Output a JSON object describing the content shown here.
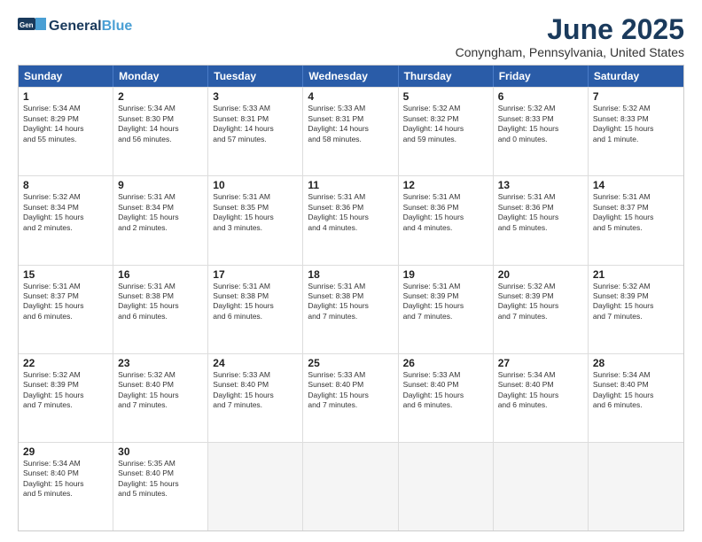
{
  "logo": {
    "line1a": "General",
    "line1b": "Blue",
    "tagline": ""
  },
  "title": "June 2025",
  "subtitle": "Conyngham, Pennsylvania, United States",
  "days_of_week": [
    "Sunday",
    "Monday",
    "Tuesday",
    "Wednesday",
    "Thursday",
    "Friday",
    "Saturday"
  ],
  "weeks": [
    [
      {
        "day": "1",
        "info": "Sunrise: 5:34 AM\nSunset: 8:29 PM\nDaylight: 14 hours\nand 55 minutes."
      },
      {
        "day": "2",
        "info": "Sunrise: 5:34 AM\nSunset: 8:30 PM\nDaylight: 14 hours\nand 56 minutes."
      },
      {
        "day": "3",
        "info": "Sunrise: 5:33 AM\nSunset: 8:31 PM\nDaylight: 14 hours\nand 57 minutes."
      },
      {
        "day": "4",
        "info": "Sunrise: 5:33 AM\nSunset: 8:31 PM\nDaylight: 14 hours\nand 58 minutes."
      },
      {
        "day": "5",
        "info": "Sunrise: 5:32 AM\nSunset: 8:32 PM\nDaylight: 14 hours\nand 59 minutes."
      },
      {
        "day": "6",
        "info": "Sunrise: 5:32 AM\nSunset: 8:33 PM\nDaylight: 15 hours\nand 0 minutes."
      },
      {
        "day": "7",
        "info": "Sunrise: 5:32 AM\nSunset: 8:33 PM\nDaylight: 15 hours\nand 1 minute."
      }
    ],
    [
      {
        "day": "8",
        "info": "Sunrise: 5:32 AM\nSunset: 8:34 PM\nDaylight: 15 hours\nand 2 minutes."
      },
      {
        "day": "9",
        "info": "Sunrise: 5:31 AM\nSunset: 8:34 PM\nDaylight: 15 hours\nand 2 minutes."
      },
      {
        "day": "10",
        "info": "Sunrise: 5:31 AM\nSunset: 8:35 PM\nDaylight: 15 hours\nand 3 minutes."
      },
      {
        "day": "11",
        "info": "Sunrise: 5:31 AM\nSunset: 8:36 PM\nDaylight: 15 hours\nand 4 minutes."
      },
      {
        "day": "12",
        "info": "Sunrise: 5:31 AM\nSunset: 8:36 PM\nDaylight: 15 hours\nand 4 minutes."
      },
      {
        "day": "13",
        "info": "Sunrise: 5:31 AM\nSunset: 8:36 PM\nDaylight: 15 hours\nand 5 minutes."
      },
      {
        "day": "14",
        "info": "Sunrise: 5:31 AM\nSunset: 8:37 PM\nDaylight: 15 hours\nand 5 minutes."
      }
    ],
    [
      {
        "day": "15",
        "info": "Sunrise: 5:31 AM\nSunset: 8:37 PM\nDaylight: 15 hours\nand 6 minutes."
      },
      {
        "day": "16",
        "info": "Sunrise: 5:31 AM\nSunset: 8:38 PM\nDaylight: 15 hours\nand 6 minutes."
      },
      {
        "day": "17",
        "info": "Sunrise: 5:31 AM\nSunset: 8:38 PM\nDaylight: 15 hours\nand 6 minutes."
      },
      {
        "day": "18",
        "info": "Sunrise: 5:31 AM\nSunset: 8:38 PM\nDaylight: 15 hours\nand 7 minutes."
      },
      {
        "day": "19",
        "info": "Sunrise: 5:31 AM\nSunset: 8:39 PM\nDaylight: 15 hours\nand 7 minutes."
      },
      {
        "day": "20",
        "info": "Sunrise: 5:32 AM\nSunset: 8:39 PM\nDaylight: 15 hours\nand 7 minutes."
      },
      {
        "day": "21",
        "info": "Sunrise: 5:32 AM\nSunset: 8:39 PM\nDaylight: 15 hours\nand 7 minutes."
      }
    ],
    [
      {
        "day": "22",
        "info": "Sunrise: 5:32 AM\nSunset: 8:39 PM\nDaylight: 15 hours\nand 7 minutes."
      },
      {
        "day": "23",
        "info": "Sunrise: 5:32 AM\nSunset: 8:40 PM\nDaylight: 15 hours\nand 7 minutes."
      },
      {
        "day": "24",
        "info": "Sunrise: 5:33 AM\nSunset: 8:40 PM\nDaylight: 15 hours\nand 7 minutes."
      },
      {
        "day": "25",
        "info": "Sunrise: 5:33 AM\nSunset: 8:40 PM\nDaylight: 15 hours\nand 7 minutes."
      },
      {
        "day": "26",
        "info": "Sunrise: 5:33 AM\nSunset: 8:40 PM\nDaylight: 15 hours\nand 6 minutes."
      },
      {
        "day": "27",
        "info": "Sunrise: 5:34 AM\nSunset: 8:40 PM\nDaylight: 15 hours\nand 6 minutes."
      },
      {
        "day": "28",
        "info": "Sunrise: 5:34 AM\nSunset: 8:40 PM\nDaylight: 15 hours\nand 6 minutes."
      }
    ],
    [
      {
        "day": "29",
        "info": "Sunrise: 5:34 AM\nSunset: 8:40 PM\nDaylight: 15 hours\nand 5 minutes."
      },
      {
        "day": "30",
        "info": "Sunrise: 5:35 AM\nSunset: 8:40 PM\nDaylight: 15 hours\nand 5 minutes."
      },
      {
        "day": "",
        "info": ""
      },
      {
        "day": "",
        "info": ""
      },
      {
        "day": "",
        "info": ""
      },
      {
        "day": "",
        "info": ""
      },
      {
        "day": "",
        "info": ""
      }
    ]
  ]
}
